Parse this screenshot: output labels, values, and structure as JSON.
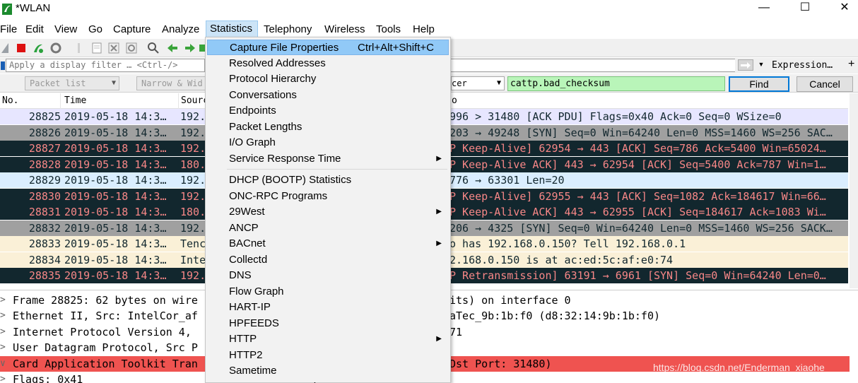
{
  "window": {
    "title": "*WLAN",
    "minimize": "—",
    "maximize": "☐",
    "close": "✕"
  },
  "menubar": [
    "File",
    "Edit",
    "View",
    "Go",
    "Capture",
    "Analyze",
    "Statistics",
    "Telephony",
    "Wireless",
    "Tools",
    "Help"
  ],
  "active_menu": "Statistics",
  "filter": {
    "placeholder": "Apply a display filter … <Ctrl-/>",
    "expression_label": "Expression…",
    "add_label": "+"
  },
  "findbar": {
    "display_option": "Packet list",
    "char_option": "Narrow & Wid",
    "search_type": "cer",
    "search_value": "cattp.bad_checksum",
    "find_label": "Find",
    "cancel_label": "Cancel"
  },
  "packet_list": {
    "columns": [
      "No.",
      "Time",
      "Sourc",
      "o"
    ],
    "rows": [
      {
        "no": "28825",
        "time": "2019-05-18 14:3…",
        "src": "192.",
        "info": "996 > 31480 [ACK PDU] Flags=0x40 Ack=0 Seq=0 WSize=0",
        "style": "tcp"
      },
      {
        "no": "28826",
        "time": "2019-05-18 14:3…",
        "src": "192.",
        "info": "203 → 49248 [SYN] Seq=0 Win=64240 Len=0 MSS=1460 WS=256 SAC…",
        "style": "syn"
      },
      {
        "no": "28827",
        "time": "2019-05-18 14:3…",
        "src": "192.",
        "info": "P Keep-Alive] 62954 → 443 [ACK] Seq=786 Ack=5400 Win=65024…",
        "style": "bad"
      },
      {
        "no": "28828",
        "time": "2019-05-18 14:3…",
        "src": "180.",
        "info": "P Keep-Alive ACK] 443 → 62954 [ACK] Seq=5400 Ack=787 Win=1…",
        "style": "bad"
      },
      {
        "no": "28829",
        "time": "2019-05-18 14:3…",
        "src": "192.",
        "info": "776 → 63301 Len=20",
        "style": "udp"
      },
      {
        "no": "28830",
        "time": "2019-05-18 14:3…",
        "src": "192.",
        "info": "P Keep-Alive] 62955 → 443 [ACK] Seq=1082 Ack=184617 Win=66…",
        "style": "bad"
      },
      {
        "no": "28831",
        "time": "2019-05-18 14:3…",
        "src": "180.",
        "info": "P Keep-Alive ACK] 443 → 62955 [ACK] Seq=184617 Ack=1083 Wi…",
        "style": "bad"
      },
      {
        "no": "28832",
        "time": "2019-05-18 14:3…",
        "src": "192.",
        "info": "206 → 4325 [SYN] Seq=0 Win=64240 Len=0 MSS=1460 WS=256 SACK…",
        "style": "syn"
      },
      {
        "no": "28833",
        "time": "2019-05-18 14:3…",
        "src": "Tenc",
        "info": "o has 192.168.0.150? Tell 192.168.0.1",
        "style": "arp"
      },
      {
        "no": "28834",
        "time": "2019-05-18 14:3…",
        "src": "Inte",
        "info": "2.168.0.150 is at ac:ed:5c:af:e0:74",
        "style": "arp"
      },
      {
        "no": "28835",
        "time": "2019-05-18 14:3…",
        "src": "192.",
        "info": "P Retransmission] 63191 → 6961 [SYN] Seq=0 Win=64240 Len=0…",
        "style": "bad"
      }
    ]
  },
  "details": [
    {
      "exp": ">",
      "left": "Frame 28825: 62 bytes on wire",
      "right": "its) on interface 0",
      "style": ""
    },
    {
      "exp": ">",
      "left": "Ethernet II, Src: IntelCor_af",
      "right": "aTec_9b:1b:f0 (d8:32:14:9b:1b:f0)",
      "style": ""
    },
    {
      "exp": ">",
      "left": "Internet Protocol Version 4,",
      "right": "71",
      "style": ""
    },
    {
      "exp": ">",
      "left": "User Datagram Protocol, Src P",
      "right": "",
      "style": ""
    },
    {
      "exp": "∨",
      "left": "Card Application Toolkit Tran",
      "right": "Dst Port: 31480)",
      "style": "err"
    },
    {
      "exp": ">",
      "left": "  Flags: 0x41",
      "right": "",
      "style": ""
    }
  ],
  "watermark": "https://blog.csdn.net/Enderman_xiaohe",
  "statistics_menu": [
    {
      "label": "Capture File Properties",
      "shortcut": "Ctrl+Alt+Shift+C",
      "highlight": true
    },
    {
      "label": "Resolved Addresses"
    },
    {
      "label": "Protocol Hierarchy"
    },
    {
      "label": "Conversations"
    },
    {
      "label": "Endpoints"
    },
    {
      "label": "Packet Lengths"
    },
    {
      "label": "I/O Graph"
    },
    {
      "label": "Service Response Time",
      "submenu": true
    },
    {
      "separator": true
    },
    {
      "label": "DHCP (BOOTP) Statistics"
    },
    {
      "label": "ONC-RPC Programs"
    },
    {
      "label": "29West",
      "submenu": true
    },
    {
      "label": "ANCP"
    },
    {
      "label": "BACnet",
      "submenu": true
    },
    {
      "label": "Collectd"
    },
    {
      "label": "DNS"
    },
    {
      "label": "Flow Graph"
    },
    {
      "label": "HART-IP"
    },
    {
      "label": "HPFEEDS"
    },
    {
      "label": "HTTP",
      "submenu": true
    },
    {
      "label": "HTTP2"
    },
    {
      "label": "Sametime"
    },
    {
      "label": "TCP Stream Graphs"
    }
  ],
  "colors": {
    "menu_highlight": "#91c9f7",
    "search_green": "#b9f5b9",
    "bad_row_bg": "#12272e",
    "bad_row_fg": "#f78787",
    "error_row": "#ef5350"
  }
}
